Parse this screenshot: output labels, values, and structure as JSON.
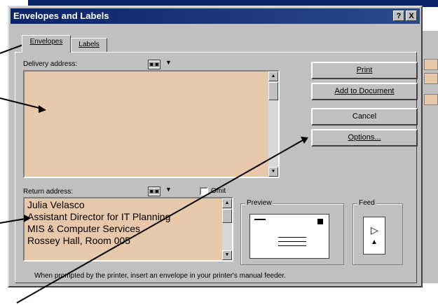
{
  "window": {
    "title": "Envelopes and Labels",
    "help_btn": "?",
    "close_btn": "X"
  },
  "tabs": [
    {
      "label": "Envelopes"
    },
    {
      "label": "Labels"
    }
  ],
  "delivery": {
    "label": "Delivery address:",
    "text": ""
  },
  "return": {
    "label": "Return address:",
    "omit_label": "Omit",
    "lines": [
      "Julia Velasco",
      "Assistant Director for IT Planning",
      "MIS & Computer Services",
      "Rossey Hall, Room 005"
    ]
  },
  "buttons": {
    "print": "Print",
    "add_to_document": "Add to Document",
    "cancel": "Cancel",
    "options": "Options..."
  },
  "preview": {
    "label": "Preview"
  },
  "feed": {
    "label": "Feed"
  },
  "footer": "When prompted by the printer, insert an envelope in your printer's manual feeder.",
  "colors": {
    "address_bg": "#e8c8ab",
    "titlebar": "#0a246a",
    "dialog": "#c0c0c0"
  }
}
